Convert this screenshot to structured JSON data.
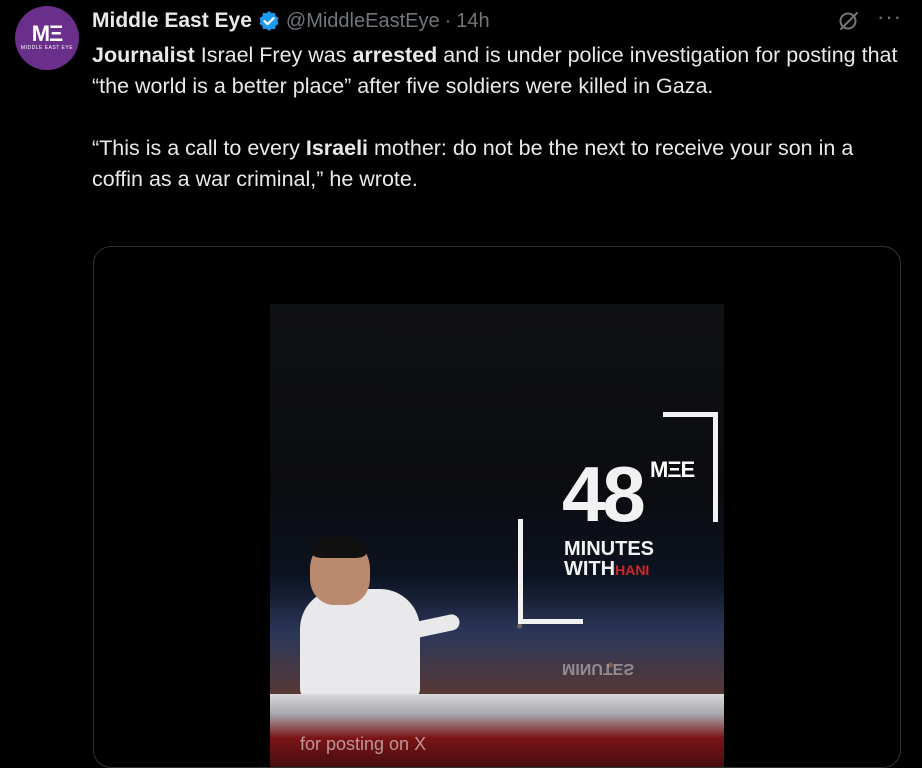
{
  "tweet": {
    "author": {
      "name": "Middle East Eye",
      "handle": "@MiddleEastEye",
      "avatar_logo": "MΞ",
      "avatar_subtitle": "MIDDLE EAST EYE"
    },
    "separator": "·",
    "timestamp": "14h",
    "more_label": "···",
    "body": {
      "p1": {
        "bold1": "Journalist",
        "t1": " Israel Frey was ",
        "bold2": "arrested",
        "t2": " and is under police investigation for posting that “the world is a better place” after five soldiers were killed in Gaza."
      },
      "p2": {
        "t1": "“This is a call to every ",
        "bold1": "Israeli",
        "t2": " mother: do not be the next to receive your son in a coffin as a war criminal,” he wrote."
      }
    },
    "media": {
      "overlay_number": "48",
      "overlay_logo": "MΞE",
      "overlay_line1": "MINUTES",
      "overlay_line2_prefix": "WITH",
      "overlay_line2_suffix": "HANI",
      "reflection_text": "MINUTES",
      "caption": "for posting on X"
    }
  },
  "colors": {
    "background": "#000000",
    "text_primary": "#e7e9ea",
    "text_secondary": "#71767b",
    "verified_blue": "#1d9bf0",
    "avatar_purple": "#6a2f8a",
    "accent_red": "#d6242a"
  },
  "icons": [
    "verified-badge-icon",
    "grok-icon",
    "more-icon"
  ]
}
